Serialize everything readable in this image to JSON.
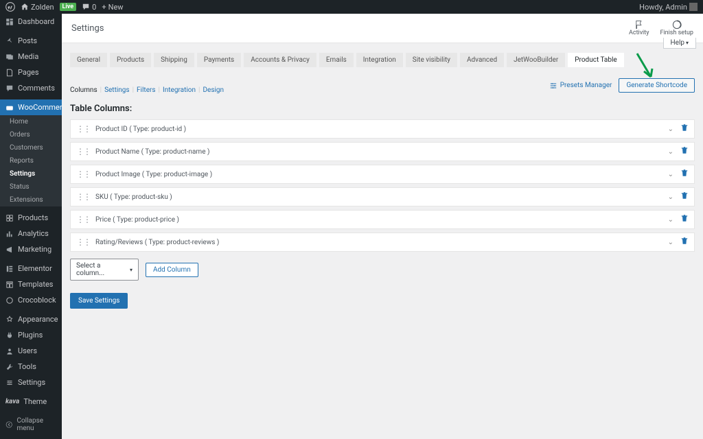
{
  "adminbar": {
    "site_name": "Zolden",
    "live": "Live",
    "comments": "0",
    "new": "New",
    "howdy": "Howdy, Admin"
  },
  "sidebar": {
    "items": [
      {
        "label": "Dashboard",
        "icon": "dashboard"
      },
      {
        "label": "Posts",
        "icon": "pin"
      },
      {
        "label": "Media",
        "icon": "media"
      },
      {
        "label": "Pages",
        "icon": "page"
      },
      {
        "label": "Comments",
        "icon": "comment"
      },
      {
        "label": "WooCommerce",
        "icon": "woo",
        "current": true,
        "submenu": [
          "Home",
          "Orders",
          "Customers",
          "Reports",
          "Settings",
          "Status",
          "Extensions"
        ],
        "sub_active": 4
      },
      {
        "label": "Products",
        "icon": "products"
      },
      {
        "label": "Analytics",
        "icon": "analytics"
      },
      {
        "label": "Marketing",
        "icon": "marketing"
      },
      {
        "label": "Elementor",
        "icon": "elementor"
      },
      {
        "label": "Templates",
        "icon": "templates"
      },
      {
        "label": "Crocoblock",
        "icon": "croco"
      },
      {
        "label": "Appearance",
        "icon": "appearance"
      },
      {
        "label": "Plugins",
        "icon": "plugins"
      },
      {
        "label": "Users",
        "icon": "users"
      },
      {
        "label": "Tools",
        "icon": "tools"
      },
      {
        "label": "Settings",
        "icon": "settings"
      }
    ],
    "kava": "Theme",
    "collapse": "Collapse menu"
  },
  "header": {
    "title": "Settings",
    "activity": "Activity",
    "finish": "Finish setup",
    "help": "Help"
  },
  "tabs": [
    "General",
    "Products",
    "Shipping",
    "Payments",
    "Accounts & Privacy",
    "Emails",
    "Integration",
    "Site visibility",
    "Advanced",
    "JetWooBuilder",
    "Product Table"
  ],
  "tabs_active": 10,
  "subtabs": [
    "Columns",
    "Settings",
    "Filters",
    "Integration",
    "Design"
  ],
  "subtabs_active": 0,
  "tools": {
    "presets": "Presets Manager",
    "generate": "Generate Shortcode"
  },
  "section_title": "Table Columns:",
  "columns": [
    "Product ID ( Type: product-id )",
    "Product Name ( Type: product-name )",
    "Product Image ( Type: product-image )",
    "SKU ( Type: product-sku )",
    "Price ( Type: product-price )",
    "Rating/Reviews ( Type: product-reviews )"
  ],
  "select_placeholder": "Select a column...",
  "add_column": "Add Column",
  "save": "Save Settings"
}
